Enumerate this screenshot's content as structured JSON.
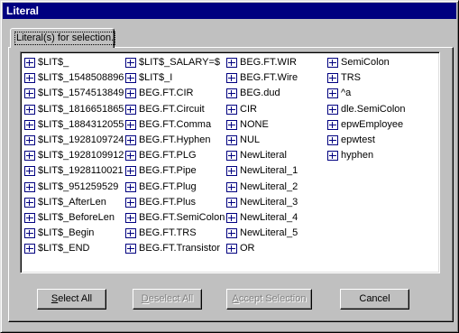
{
  "window": {
    "title": "Literal"
  },
  "tab": {
    "label": "Literal(s) for selection."
  },
  "list": {
    "columns": [
      [
        "$LIT$_",
        "$LIT$_1548508896",
        "$LIT$_1574513849",
        "$LIT$_1816651865",
        "$LIT$_1884312055",
        "$LIT$_1928109724",
        "$LIT$_1928109912",
        "$LIT$_1928110021",
        "$LIT$_951259529",
        "$LIT$_AfterLen",
        "$LIT$_BeforeLen",
        "$LIT$_Begin",
        "$LIT$_END"
      ],
      [
        "$LIT$_SALARY=$",
        "$LIT$_I",
        "BEG.FT.CIR",
        "BEG.FT.Circuit",
        "BEG.FT.Comma",
        "BEG.FT.Hyphen",
        "BEG.FT.PLG",
        "BEG.FT.Pipe",
        "BEG.FT.Plug",
        "BEG.FT.Plus",
        "BEG.FT.SemiColon",
        "BEG.FT.TRS",
        "BEG.FT.Transistor"
      ],
      [
        "BEG.FT.WIR",
        "BEG.FT.Wire",
        "BEG.dud",
        "CIR",
        "NONE",
        "NUL",
        "NewLiteral",
        "NewLiteral_1",
        "NewLiteral_2",
        "NewLiteral_3",
        "NewLiteral_4",
        "NewLiteral_5",
        "OR"
      ],
      [
        "SemiColon",
        "TRS",
        "^a",
        "dle.SemiColon",
        "epwEmployee",
        "epwtest",
        "hyphen"
      ]
    ]
  },
  "buttons": {
    "select_all": {
      "underline": "S",
      "rest": "elect All"
    },
    "deselect_all": {
      "underline": "D",
      "rest": "eselect All"
    },
    "accept_selection": {
      "underline": "A",
      "rest": "ccept Selection"
    },
    "cancel": "Cancel"
  },
  "icons": {
    "list_item": "literal-icon"
  }
}
